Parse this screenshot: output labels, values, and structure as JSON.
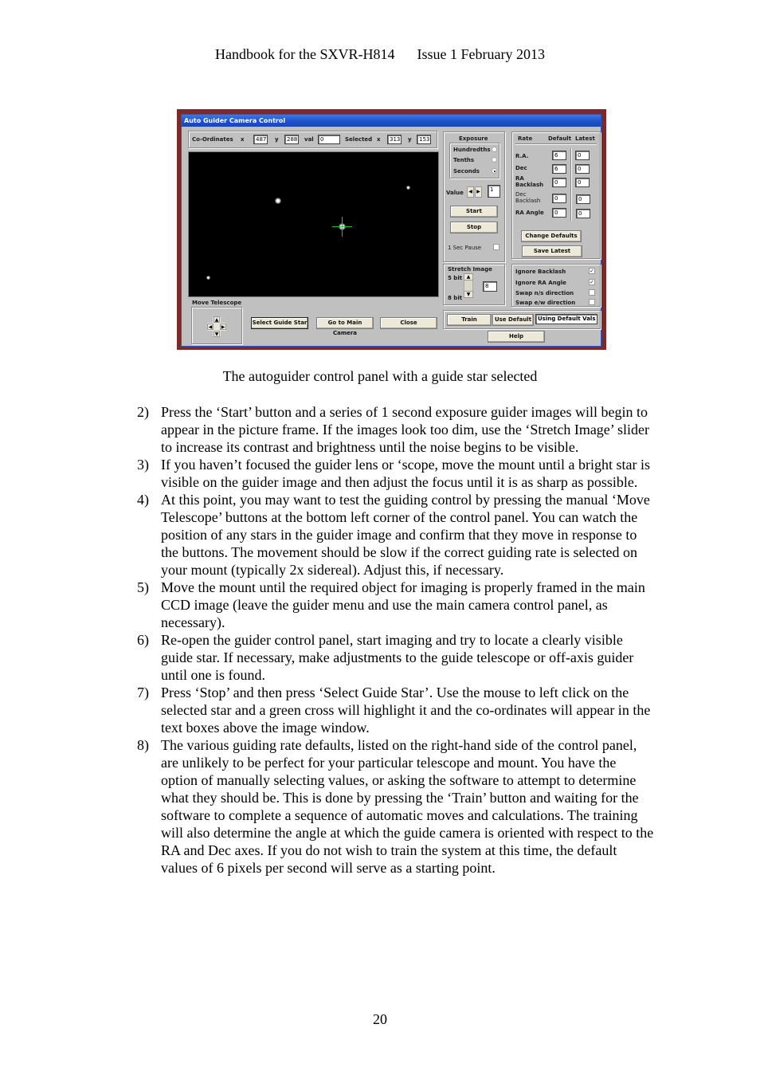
{
  "header": {
    "left": "Handbook for the SXVR-H814",
    "right": "Issue 1 February 2013"
  },
  "window": {
    "title": "Auto Guider Camera Control",
    "coords": {
      "label": "Co-Ordinates",
      "x_label": "x",
      "x_value": "487",
      "y_label": "y",
      "y_value": "288",
      "val_label": "val",
      "val_value": "0",
      "selected_label": "Selected",
      "sel_x_label": "x",
      "sel_x_value": "313",
      "sel_y_label": "y",
      "sel_y_value": "153"
    },
    "exposure": {
      "title": "Exposure",
      "options": [
        "Hundredths",
        "Tenths",
        "Seconds"
      ],
      "selected": "Seconds",
      "value_label": "Value",
      "value": "1",
      "start_label": "Start",
      "stop_label": "Stop",
      "pause_label": "1 Sec Pause",
      "pause_checked": false
    },
    "rate": {
      "col_rate": "Rate",
      "col_default": "Default",
      "col_latest": "Latest",
      "rows": [
        {
          "label": "R.A.",
          "default": "6",
          "latest": "0"
        },
        {
          "label": "Dec",
          "default": "6",
          "latest": "0"
        },
        {
          "label": "RA Backlash",
          "default": "0",
          "latest": "0"
        },
        {
          "label": "Dec Backlash",
          "default": "0",
          "latest": "0"
        },
        {
          "label": "RA Angle",
          "default": "0",
          "latest": "0"
        }
      ],
      "change_defaults_label": "Change Defaults",
      "save_latest_label": "Save Latest"
    },
    "stretch": {
      "title": "Stretch Image",
      "top_label": "5 bit",
      "bottom_label": "8 bit",
      "value": "8"
    },
    "options": [
      {
        "label": "Ignore Backlash",
        "checked": true
      },
      {
        "label": "Ignore RA Angle",
        "checked": true
      },
      {
        "label": "Swap n/s direction",
        "checked": false
      },
      {
        "label": "Swap e/w direction",
        "checked": false
      }
    ],
    "train_label": "Train",
    "use_default_label": "Use Default",
    "status_text": "Using Default Vals",
    "help_label": "Help",
    "move_telescope_label": "Move Telescope",
    "select_guide_star_label": "Select Guide Star",
    "go_to_main_label": "Go to Main Camera",
    "close_label": "Close",
    "arrows": {
      "up": "▲",
      "down": "▼",
      "left": "◀",
      "right": "▶"
    },
    "checkmark": "✓"
  },
  "caption": "The autoguider control panel with a guide star selected",
  "steps": [
    {
      "num": "2)",
      "text": "Press the ‘Start’ button and a series of 1 second exposure guider images will begin to appear in the picture frame. If the images look too dim, use the ‘Stretch Image’ slider to increase its contrast and brightness until the noise begins to be visible."
    },
    {
      "num": "3)",
      "text": "If you haven’t focused the guider lens or ‘scope, move the mount until a bright star is visible on the guider image and then adjust the focus until it is as sharp as possible."
    },
    {
      "num": "4)",
      "text": "At this point, you may want to test the guiding control by pressing the manual ‘Move Telescope’ buttons at the bottom left corner of the control panel. You can watch the position of any stars in the guider image and confirm that they move in response to the buttons. The movement should be slow if the correct guiding rate is selected on your mount (typically 2x sidereal). Adjust this, if necessary."
    },
    {
      "num": "5)",
      "text": "Move the mount until the required object for imaging is properly framed in the main CCD image (leave the guider menu and use the main camera control panel, as necessary)."
    },
    {
      "num": "6)",
      "text": "Re-open the guider control panel, start imaging and try to locate a clearly visible guide star. If necessary, make adjustments to the guide telescope or off-axis guider until one is found."
    },
    {
      "num": "7)",
      "text": "Press ‘Stop’ and then press ‘Select Guide Star’. Use the mouse to left click on the selected star and a green cross will highlight it and the co-ordinates will appear in the text boxes above the image window."
    },
    {
      "num": "8)",
      "text": "The various guiding rate defaults, listed on the right-hand side of the control panel, are unlikely to be perfect for your particular telescope and mount. You have the option of manually selecting values, or asking the software to attempt to determine what they should be. This is done by pressing the ‘Train’ button and waiting for the software to complete a sequence of automatic moves and calculations. The training will also determine the angle at which the guide camera is oriented with respect to the RA and Dec axes. If you do not wish to train the system at this time, the default values of 6 pixels per second will serve as a starting point."
    }
  ],
  "page_number": "20"
}
